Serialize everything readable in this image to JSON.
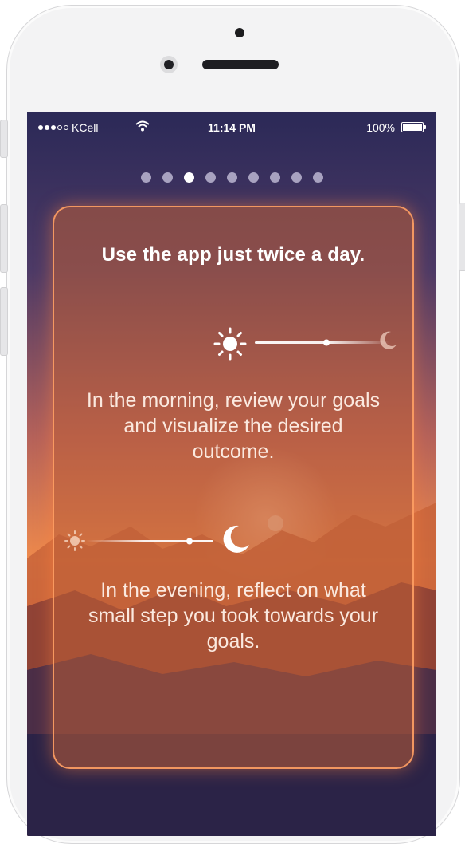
{
  "status_bar": {
    "carrier": "KCell",
    "time": "11:14 PM",
    "battery": "100%"
  },
  "pagination": {
    "total": 9,
    "active_index": 2
  },
  "card": {
    "title": "Use the app just twice a day.",
    "morning_text": "In the morning, review your goals and visualize the desired outcome.",
    "evening_text": "In the evening, reflect on what small step you took towards your goals."
  },
  "icons": [
    "sun-icon",
    "moon-icon",
    "wifi-icon",
    "battery-icon"
  ],
  "colors": {
    "card_border": "#ffa064",
    "card_fill": "#be5f37",
    "sky_top": "#2f2a5a",
    "horizon": "#e8834a"
  }
}
